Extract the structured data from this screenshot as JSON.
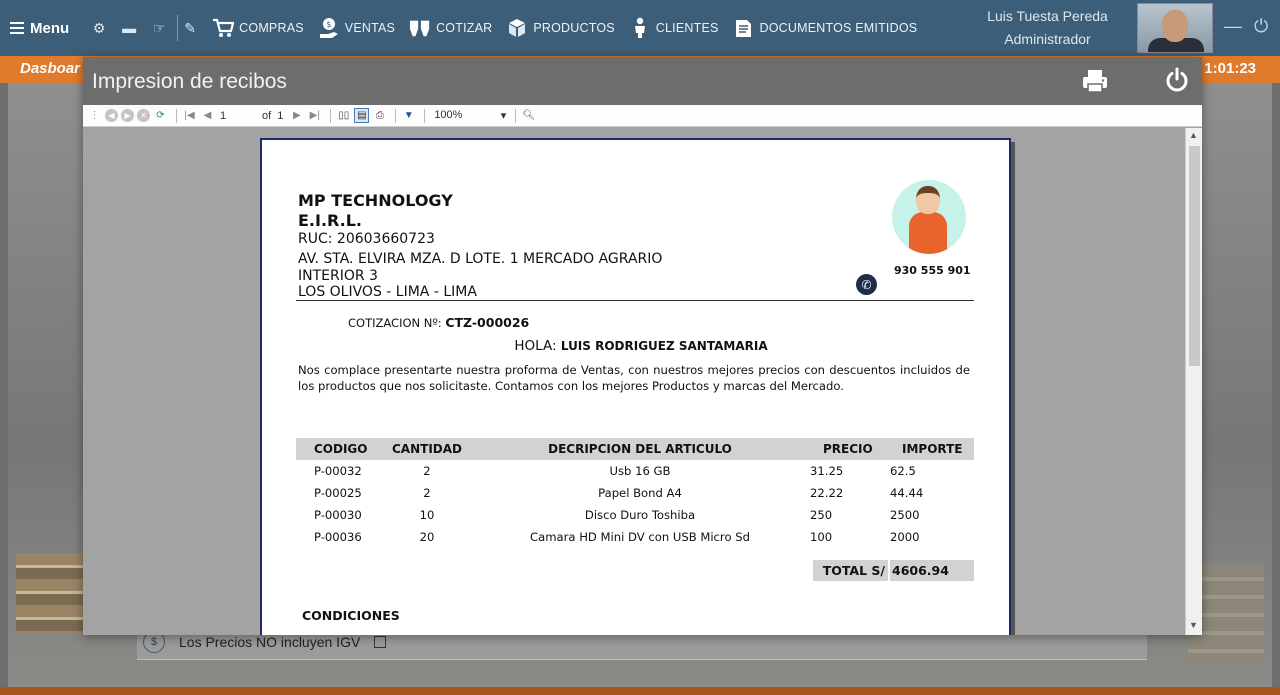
{
  "topbar": {
    "menu_label": "Menu",
    "nav": [
      {
        "label": "COMPRAS",
        "icon": "cart-icon"
      },
      {
        "label": "VENTAS",
        "icon": "sales-hand-icon"
      },
      {
        "label": "COTIZAR",
        "icon": "quote-icon"
      },
      {
        "label": "PRODUCTOS",
        "icon": "boxes-icon"
      },
      {
        "label": "CLIENTES",
        "icon": "users-icon"
      },
      {
        "label": "DOCUMENTOS EMITIDOS",
        "icon": "documents-icon"
      }
    ],
    "user_name": "Luis Tuesta Pereda",
    "user_role": "Administrador"
  },
  "dashbar": {
    "title": "Dasboar",
    "time": "1:01:23"
  },
  "modal": {
    "title": "Impresion de recibos",
    "toolbar": {
      "page": "1",
      "of_label": "of",
      "total_pages": "1",
      "zoom": "100%"
    }
  },
  "receipt": {
    "company_line1": "MP TECHNOLOGY",
    "company_line2": "E.I.R.L.",
    "ruc": "RUC: 20603660723",
    "address_line1": "AV. STA. ELVIRA MZA. D LOTE. 1 MERCADO AGRARIO",
    "address_line2": "INTERIOR 3",
    "address_line3": "LOS OLIVOS - LIMA - LIMA",
    "phone": "930 555 901",
    "quote_label": "COTIZACION Nº:",
    "quote_number": "CTZ-000026",
    "greeting": "HOLA:",
    "customer": "LUIS RODRIGUEZ SANTAMARIA",
    "intro": "Nos complace presentarte nuestra proforma de Ventas, con nuestros mejores precios con descuentos incluidos de los productos que nos solicitaste. Contamos con los mejores Productos y marcas del Mercado.",
    "columns": [
      "CODIGO",
      "CANTIDAD",
      "DECRIPCION DEL ARTICULO",
      "PRECIO",
      "IMPORTE"
    ],
    "rows": [
      [
        "P-00032",
        "2",
        "Usb 16 GB",
        "31.25",
        "62.5"
      ],
      [
        "P-00025",
        "2",
        "Papel Bond A4",
        "22.22",
        "44.44"
      ],
      [
        "P-00030",
        "10",
        "Disco Duro Toshiba",
        "250",
        "2500"
      ],
      [
        "P-00036",
        "20",
        "Camara HD Mini DV con USB Micro Sd",
        "100",
        "2000"
      ]
    ],
    "total_label": "TOTAL S/",
    "total_value": "4606.94",
    "conditions_label": "CONDICIONES"
  },
  "background": {
    "igv_label": "Los Precios NO incluyen IGV"
  }
}
